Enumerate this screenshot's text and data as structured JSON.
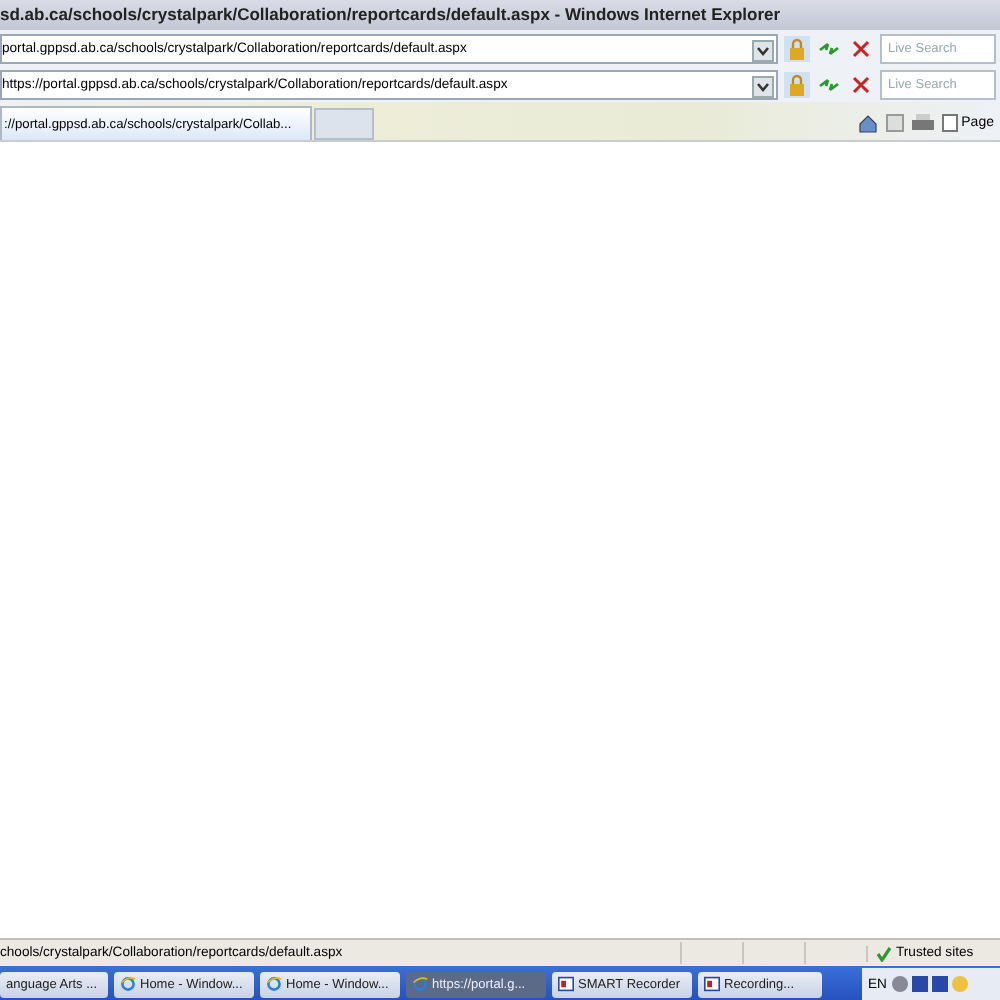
{
  "window": {
    "title": "sd.ab.ca/schools/crystalpark/Collaboration/reportcards/default.aspx - Windows Internet Explorer"
  },
  "address_bars": [
    {
      "url": "portal.gppsd.ab.ca/schools/crystalpark/Collaboration/reportcards/default.aspx",
      "search_placeholder": "Live Search"
    },
    {
      "url": "https://portal.gppsd.ab.ca/schools/crystalpark/Collaboration/reportcards/default.aspx",
      "search_placeholder": "Live Search"
    }
  ],
  "tabs": [
    {
      "label": "://portal.gppsd.ab.ca/schools/crystalpark/Collab...",
      "selected": true
    }
  ],
  "toolbar": {
    "page_menu": "Page"
  },
  "status_bar": {
    "url": "chools/crystalpark/Collaboration/reportcards/default.aspx",
    "zone": "Trusted sites"
  },
  "taskbar": {
    "items": [
      {
        "label": "anguage Arts ...",
        "kind": "plain",
        "selected": false
      },
      {
        "label": "Home - Window...",
        "kind": "browser",
        "selected": false
      },
      {
        "label": "Home - Window...",
        "kind": "browser",
        "selected": false
      },
      {
        "label": "https://portal.g...",
        "kind": "browser",
        "selected": true
      },
      {
        "label": "SMART Recorder",
        "kind": "recorder",
        "selected": false
      },
      {
        "label": "Recording...",
        "kind": "recorder",
        "selected": false
      }
    ],
    "language": "EN"
  }
}
